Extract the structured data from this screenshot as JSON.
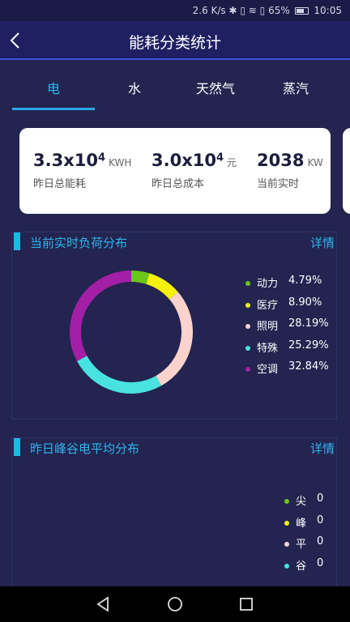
{
  "statusbar": {
    "text": "2.6 K/s ✱ ▯ ≋ ▯ 65%",
    "time": "10:05"
  },
  "header": {
    "title": "能耗分类统计"
  },
  "tabs": [
    {
      "label": "电",
      "active": true
    },
    {
      "label": "水"
    },
    {
      "label": "天然气"
    },
    {
      "label": "蒸汽"
    }
  ],
  "summary": {
    "total_energy": {
      "mantissa": "3.3x10",
      "exp": "4",
      "unit": "KWH",
      "label": "昨日总能耗"
    },
    "total_cost": {
      "mantissa": "3.0x10",
      "exp": "4",
      "unit": "元",
      "label": "昨日总成本"
    },
    "realtime": {
      "value": "2038",
      "unit": "KW",
      "label": "当前实时"
    }
  },
  "load_section": {
    "title": "当前实时负荷分布",
    "detail": "详情",
    "legend": [
      {
        "name": "动力",
        "value": "4.79%",
        "color": "#6cc51a"
      },
      {
        "name": "医疗",
        "value": "8.90%",
        "color": "#f5f10a"
      },
      {
        "name": "照明",
        "value": "28.19%",
        "color": "#fcd2cc"
      },
      {
        "name": "特殊",
        "value": "25.29%",
        "color": "#48e3e0"
      },
      {
        "name": "空调",
        "value": "32.84%",
        "color": "#a31fa5"
      }
    ]
  },
  "peak_section": {
    "title": "昨日峰谷电平均分布",
    "detail": "详情",
    "legend": [
      {
        "name": "尖",
        "value": "0",
        "color": "#6cc51a"
      },
      {
        "name": "峰",
        "value": "0",
        "color": "#f5f10a"
      },
      {
        "name": "平",
        "value": "0",
        "color": "#fcd2cc"
      },
      {
        "name": "谷",
        "value": "0",
        "color": "#48e3e0"
      }
    ]
  },
  "chart_data": {
    "type": "pie",
    "categories": [
      "动力",
      "医疗",
      "照明",
      "特殊",
      "空调"
    ],
    "values": [
      4.79,
      8.9,
      28.19,
      25.29,
      32.84
    ],
    "colors": [
      "#6cc51a",
      "#f5f10a",
      "#fcd2cc",
      "#48e3e0",
      "#a31fa5"
    ]
  }
}
